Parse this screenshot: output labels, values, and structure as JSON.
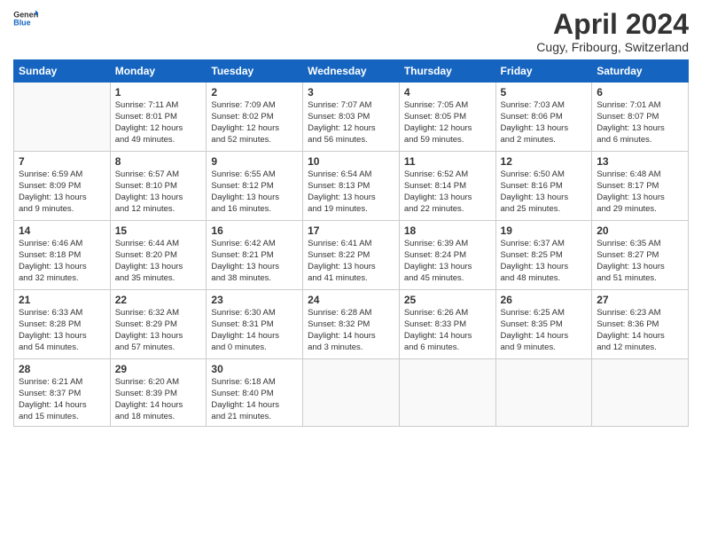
{
  "header": {
    "logo_general": "General",
    "logo_blue": "Blue",
    "title": "April 2024",
    "location": "Cugy, Fribourg, Switzerland"
  },
  "weekdays": [
    "Sunday",
    "Monday",
    "Tuesday",
    "Wednesday",
    "Thursday",
    "Friday",
    "Saturday"
  ],
  "weeks": [
    [
      {
        "day": "",
        "info": ""
      },
      {
        "day": "1",
        "info": "Sunrise: 7:11 AM\nSunset: 8:01 PM\nDaylight: 12 hours\nand 49 minutes."
      },
      {
        "day": "2",
        "info": "Sunrise: 7:09 AM\nSunset: 8:02 PM\nDaylight: 12 hours\nand 52 minutes."
      },
      {
        "day": "3",
        "info": "Sunrise: 7:07 AM\nSunset: 8:03 PM\nDaylight: 12 hours\nand 56 minutes."
      },
      {
        "day": "4",
        "info": "Sunrise: 7:05 AM\nSunset: 8:05 PM\nDaylight: 12 hours\nand 59 minutes."
      },
      {
        "day": "5",
        "info": "Sunrise: 7:03 AM\nSunset: 8:06 PM\nDaylight: 13 hours\nand 2 minutes."
      },
      {
        "day": "6",
        "info": "Sunrise: 7:01 AM\nSunset: 8:07 PM\nDaylight: 13 hours\nand 6 minutes."
      }
    ],
    [
      {
        "day": "7",
        "info": "Sunrise: 6:59 AM\nSunset: 8:09 PM\nDaylight: 13 hours\nand 9 minutes."
      },
      {
        "day": "8",
        "info": "Sunrise: 6:57 AM\nSunset: 8:10 PM\nDaylight: 13 hours\nand 12 minutes."
      },
      {
        "day": "9",
        "info": "Sunrise: 6:55 AM\nSunset: 8:12 PM\nDaylight: 13 hours\nand 16 minutes."
      },
      {
        "day": "10",
        "info": "Sunrise: 6:54 AM\nSunset: 8:13 PM\nDaylight: 13 hours\nand 19 minutes."
      },
      {
        "day": "11",
        "info": "Sunrise: 6:52 AM\nSunset: 8:14 PM\nDaylight: 13 hours\nand 22 minutes."
      },
      {
        "day": "12",
        "info": "Sunrise: 6:50 AM\nSunset: 8:16 PM\nDaylight: 13 hours\nand 25 minutes."
      },
      {
        "day": "13",
        "info": "Sunrise: 6:48 AM\nSunset: 8:17 PM\nDaylight: 13 hours\nand 29 minutes."
      }
    ],
    [
      {
        "day": "14",
        "info": "Sunrise: 6:46 AM\nSunset: 8:18 PM\nDaylight: 13 hours\nand 32 minutes."
      },
      {
        "day": "15",
        "info": "Sunrise: 6:44 AM\nSunset: 8:20 PM\nDaylight: 13 hours\nand 35 minutes."
      },
      {
        "day": "16",
        "info": "Sunrise: 6:42 AM\nSunset: 8:21 PM\nDaylight: 13 hours\nand 38 minutes."
      },
      {
        "day": "17",
        "info": "Sunrise: 6:41 AM\nSunset: 8:22 PM\nDaylight: 13 hours\nand 41 minutes."
      },
      {
        "day": "18",
        "info": "Sunrise: 6:39 AM\nSunset: 8:24 PM\nDaylight: 13 hours\nand 45 minutes."
      },
      {
        "day": "19",
        "info": "Sunrise: 6:37 AM\nSunset: 8:25 PM\nDaylight: 13 hours\nand 48 minutes."
      },
      {
        "day": "20",
        "info": "Sunrise: 6:35 AM\nSunset: 8:27 PM\nDaylight: 13 hours\nand 51 minutes."
      }
    ],
    [
      {
        "day": "21",
        "info": "Sunrise: 6:33 AM\nSunset: 8:28 PM\nDaylight: 13 hours\nand 54 minutes."
      },
      {
        "day": "22",
        "info": "Sunrise: 6:32 AM\nSunset: 8:29 PM\nDaylight: 13 hours\nand 57 minutes."
      },
      {
        "day": "23",
        "info": "Sunrise: 6:30 AM\nSunset: 8:31 PM\nDaylight: 14 hours\nand 0 minutes."
      },
      {
        "day": "24",
        "info": "Sunrise: 6:28 AM\nSunset: 8:32 PM\nDaylight: 14 hours\nand 3 minutes."
      },
      {
        "day": "25",
        "info": "Sunrise: 6:26 AM\nSunset: 8:33 PM\nDaylight: 14 hours\nand 6 minutes."
      },
      {
        "day": "26",
        "info": "Sunrise: 6:25 AM\nSunset: 8:35 PM\nDaylight: 14 hours\nand 9 minutes."
      },
      {
        "day": "27",
        "info": "Sunrise: 6:23 AM\nSunset: 8:36 PM\nDaylight: 14 hours\nand 12 minutes."
      }
    ],
    [
      {
        "day": "28",
        "info": "Sunrise: 6:21 AM\nSunset: 8:37 PM\nDaylight: 14 hours\nand 15 minutes."
      },
      {
        "day": "29",
        "info": "Sunrise: 6:20 AM\nSunset: 8:39 PM\nDaylight: 14 hours\nand 18 minutes."
      },
      {
        "day": "30",
        "info": "Sunrise: 6:18 AM\nSunset: 8:40 PM\nDaylight: 14 hours\nand 21 minutes."
      },
      {
        "day": "",
        "info": ""
      },
      {
        "day": "",
        "info": ""
      },
      {
        "day": "",
        "info": ""
      },
      {
        "day": "",
        "info": ""
      }
    ]
  ]
}
